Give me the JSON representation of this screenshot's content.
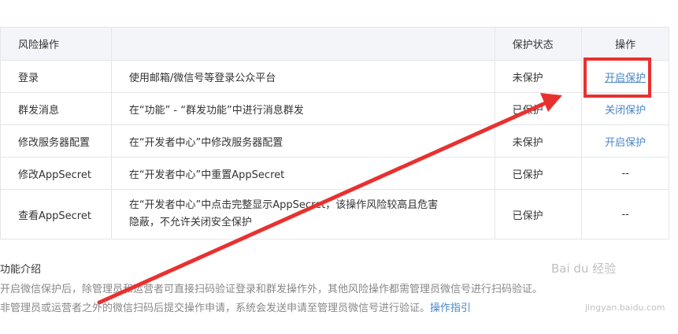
{
  "table": {
    "headers": [
      "风险操作",
      "",
      "保护状态",
      "操作"
    ],
    "rows": [
      {
        "op": "登录",
        "desc": "使用邮箱/微信号等登录公众平台",
        "status": "未保护",
        "action": "开启保护"
      },
      {
        "op": "群发消息",
        "desc": "在“功能” - “群发功能”中进行消息群发",
        "status": "已保护",
        "action": "关闭保护"
      },
      {
        "op": "修改服务器配置",
        "desc": "在“开发者中心”中修改服务器配置",
        "status": "未保护",
        "action": "开启保护"
      },
      {
        "op": "修改AppSecret",
        "desc": "在“开发者中心”中重置AppSecret",
        "status": "已保护",
        "action": "--"
      },
      {
        "op": "查看AppSecret",
        "desc_line1": "在“开发者中心”中点击完整显示AppSecret，该操作风险较高且危害",
        "desc_line2": "隐蔽，不允许关闭安全保护",
        "status": "已保护",
        "action": "--"
      }
    ]
  },
  "intro": {
    "title": "功能介绍",
    "line1": "开启微信保护后，除管理员和运营者可直接扫码验证登录和群发操作外，其他风险操作都需管理员微信号进行扫码验证。",
    "line2": "非管理员或运营者之外的微信扫码后提交操作申请，系统会发送申请至管理员微信号进行验证。",
    "guide_link": "操作指引"
  },
  "watermark": {
    "brand": "Bai du 经验",
    "url": "jingyan.baidu.com"
  },
  "colors": {
    "link": "#4a86c7",
    "highlight": "#e8312f",
    "header_bg": "#f4f5f9"
  }
}
